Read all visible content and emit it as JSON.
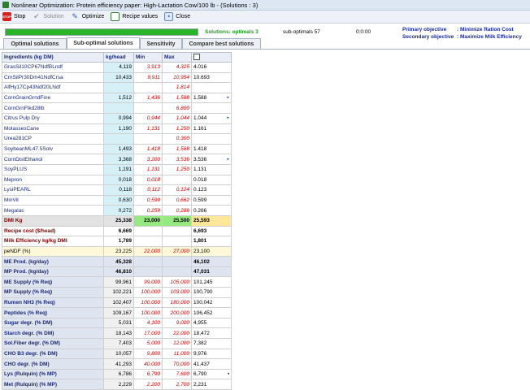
{
  "window": {
    "title": "Nonlinear Optimization:  Protein efficiency paper: High-Lactation Cow/100 lb - (Solutions : 3)"
  },
  "toolbar": {
    "stop": "Stop",
    "solution": "Solution",
    "optimize": "Optimize",
    "recipe_values": "Recipe values",
    "close": "Close"
  },
  "status": {
    "progress": 1.0,
    "solutions": "Solutions: optimals 3",
    "suboptimals": "sub-optimals 57",
    "time": "0:0:00",
    "primary_label": "Primary objective",
    "primary_value": ": Minimize Ration Cost",
    "secondary_label": "Secondary objective",
    "secondary_value": ": Maximize Milk Efficiency"
  },
  "tabs": [
    "Optimal solutions",
    "Sub-optimal solutions",
    "Sensitivity",
    "Compare best solutions"
  ],
  "grid": {
    "headers": {
      "name": "Ingredients (kg DM)",
      "kg": "kg/head",
      "min": "Min",
      "max": "Max"
    },
    "ingredients": [
      {
        "name": "GrasSil10CP67NdfBLndf",
        "kg": "4,119",
        "min": "3,913",
        "max": "4,325",
        "sol": "4.016",
        "flag": ""
      },
      {
        "name": "CrnSilPr30Dm41NdfCrsa",
        "kg": "10,433",
        "min": "9,911",
        "max": "10,954",
        "sol": "10.693",
        "flag": ""
      },
      {
        "name": "AlfHy17Cp43Ndf20LNdf",
        "kg": "",
        "min": "",
        "max": "1,814",
        "sol": "",
        "flag": ""
      },
      {
        "name": "CornGrainGrndFine",
        "kg": "1,512",
        "min": "1,436",
        "max": "1,588",
        "sol": "1.588",
        "flag": "▸"
      },
      {
        "name": "CornGrnFlkd28lb",
        "kg": "",
        "min": "",
        "max": "6,800",
        "sol": "",
        "flag": ""
      },
      {
        "name": "Citrus Pulp Dry",
        "kg": "0,994",
        "min": "0,944",
        "max": "1,044",
        "sol": "1.044",
        "flag": "▸"
      },
      {
        "name": "MolassesCane",
        "kg": "1,190",
        "min": "1,131",
        "max": "1,250",
        "sol": "1.161",
        "flag": ""
      },
      {
        "name": "Urea281CP",
        "kg": "",
        "min": "",
        "max": "0,300",
        "sol": "",
        "flag": ""
      },
      {
        "name": "SoybeanML47.5Solv",
        "kg": "1,493",
        "min": "1,418",
        "max": "1,568",
        "sol": "1.418",
        "flag": ""
      },
      {
        "name": "CornDistEthanol",
        "kg": "3,368",
        "min": "3,200",
        "max": "3,536",
        "sol": "3.536",
        "flag": "▸"
      },
      {
        "name": "SoyPLUS",
        "kg": "1,191",
        "min": "1,131",
        "max": "1,250",
        "sol": "1.131",
        "flag": ""
      },
      {
        "name": "Mepron",
        "kg": "0,018",
        "min": "0,018",
        "max": "",
        "sol": "0.018",
        "flag": ""
      },
      {
        "name": "LysiPEARL",
        "kg": "0,118",
        "min": "0,112",
        "max": "0,124",
        "sol": "0.123",
        "flag": ""
      },
      {
        "name": "MinVit",
        "kg": "0,630",
        "min": "0,599",
        "max": "0,662",
        "sol": "0.599",
        "flag": ""
      },
      {
        "name": "Megalac",
        "kg": "0,272",
        "min": "0,259",
        "max": "0,286",
        "sol": "0.266",
        "flag": ""
      }
    ],
    "dmi": {
      "name": "DMI Kg",
      "kg": "25,338",
      "min": "23,000",
      "max": "25,500",
      "sol": "25,593"
    },
    "recipe_cost": {
      "name": "Recipe cost ($/head)",
      "kg": "6,669",
      "sol": "6,693"
    },
    "milk_eff": {
      "name": "Milk Efficiency kg/kg DMI",
      "kg": "1,789",
      "sol": "1,801"
    },
    "pendf": {
      "name": "peNDF (%)",
      "kg": "23,225",
      "min": "22,000",
      "max": "27,000",
      "sol": "23,100"
    },
    "production": [
      {
        "name": "ME Prod. (kg/day)",
        "kg": "45,328",
        "sol": "46,102"
      },
      {
        "name": "MP Prod. (kg/day)",
        "kg": "46,810",
        "sol": "47,031"
      }
    ],
    "supply": [
      {
        "name": "ME Supply (% Req)",
        "kg": "99,961",
        "min": "99,000",
        "max": "105,000",
        "sol": "101,245"
      },
      {
        "name": "MP Supply (% Req)",
        "kg": "102,221",
        "min": "100,000",
        "max": "103,000",
        "sol": "100,790"
      },
      {
        "name": "Rumen NH3 (% Req)",
        "kg": "102,407",
        "min": "100,000",
        "max": "180,000",
        "sol": "100,042"
      },
      {
        "name": "Peptides (% Req)",
        "kg": "109,167",
        "min": "100,000",
        "max": "200,000",
        "sol": "106,452"
      },
      {
        "name": "Sugar degr. (% DM)",
        "kg": "5,031",
        "min": "4,100",
        "max": "9,000",
        "sol": "4,955"
      },
      {
        "name": "Starch degr. (% DM)",
        "kg": "18,143",
        "min": "17,000",
        "max": "22,000",
        "sol": "18,472"
      },
      {
        "name": "Sol.Fiber degr. (% DM)",
        "kg": "7,403",
        "min": "5,000",
        "max": "12,000",
        "sol": "7,382"
      },
      {
        "name": "CHO B3 degr. (% DM)",
        "kg": "10,057",
        "min": "9,800",
        "max": "11,000",
        "sol": "9,976"
      },
      {
        "name": "CHO degr. (% DM)",
        "kg": "41,293",
        "min": "40,000",
        "max": "70,000",
        "sol": "41,437"
      },
      {
        "name": "Lys (Rulquin) (% MP)",
        "kg": "6,786",
        "min": "6,790",
        "max": "7,600",
        "sol": "6,790",
        "flag": "◂"
      },
      {
        "name": "Met (Rulquin) (% MP)",
        "kg": "2,229",
        "min": "2,200",
        "max": "2,700",
        "sol": "2,231"
      }
    ]
  }
}
